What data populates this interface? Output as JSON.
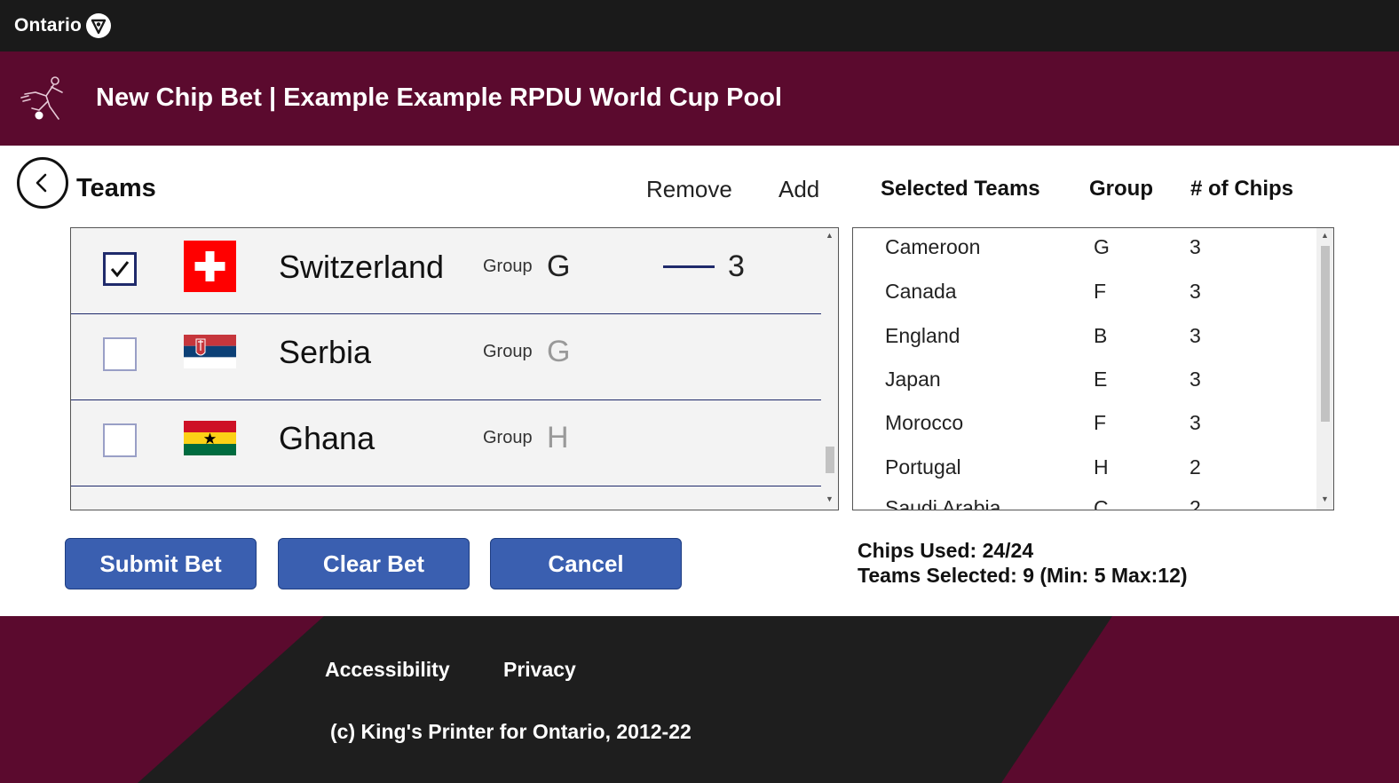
{
  "topbar": {
    "brand": "Ontario",
    "logo_icon": "ontario-trillium-icon"
  },
  "header": {
    "title": "New Chip Bet | Example Example RPDU World Cup Pool",
    "icon": "soccer-player-icon"
  },
  "toolbar": {
    "teams_heading": "Teams",
    "remove_label": "Remove",
    "add_label": "Add",
    "selected_teams_header": "Selected Teams",
    "group_header": "Group",
    "chips_header": "# of Chips"
  },
  "teams": [
    {
      "name": "Switzerland",
      "group_label": "Group",
      "group": "G",
      "checked": true,
      "chips": "3"
    },
    {
      "name": "Serbia",
      "group_label": "Group",
      "group": "G",
      "checked": false
    },
    {
      "name": "Ghana",
      "group_label": "Group",
      "group": "H",
      "checked": false
    }
  ],
  "selected_teams": [
    {
      "team": "Cameroon",
      "group": "G",
      "chips": "3"
    },
    {
      "team": "Canada",
      "group": "F",
      "chips": "3"
    },
    {
      "team": "England",
      "group": "B",
      "chips": "3"
    },
    {
      "team": "Japan",
      "group": "E",
      "chips": "3"
    },
    {
      "team": "Morocco",
      "group": "F",
      "chips": "3"
    },
    {
      "team": "Portugal",
      "group": "H",
      "chips": "2"
    },
    {
      "team": "Saudi Arabia",
      "group": "C",
      "chips": "2"
    }
  ],
  "buttons": {
    "submit": "Submit Bet",
    "clear": "Clear Bet",
    "cancel": "Cancel"
  },
  "stats": {
    "chips_used": "Chips Used: 24/24",
    "teams_selected": "Teams Selected: 9 (Min: 5 Max:12)"
  },
  "footer": {
    "accessibility": "Accessibility",
    "privacy": "Privacy",
    "copyright": "(c) King's Printer for Ontario, 2012-22"
  },
  "colors": {
    "header_bg": "#5b0a2e",
    "topbar_bg": "#1a1a1a",
    "button_bg": "#3a5fb0",
    "accent_navy": "#1f2a6b"
  }
}
